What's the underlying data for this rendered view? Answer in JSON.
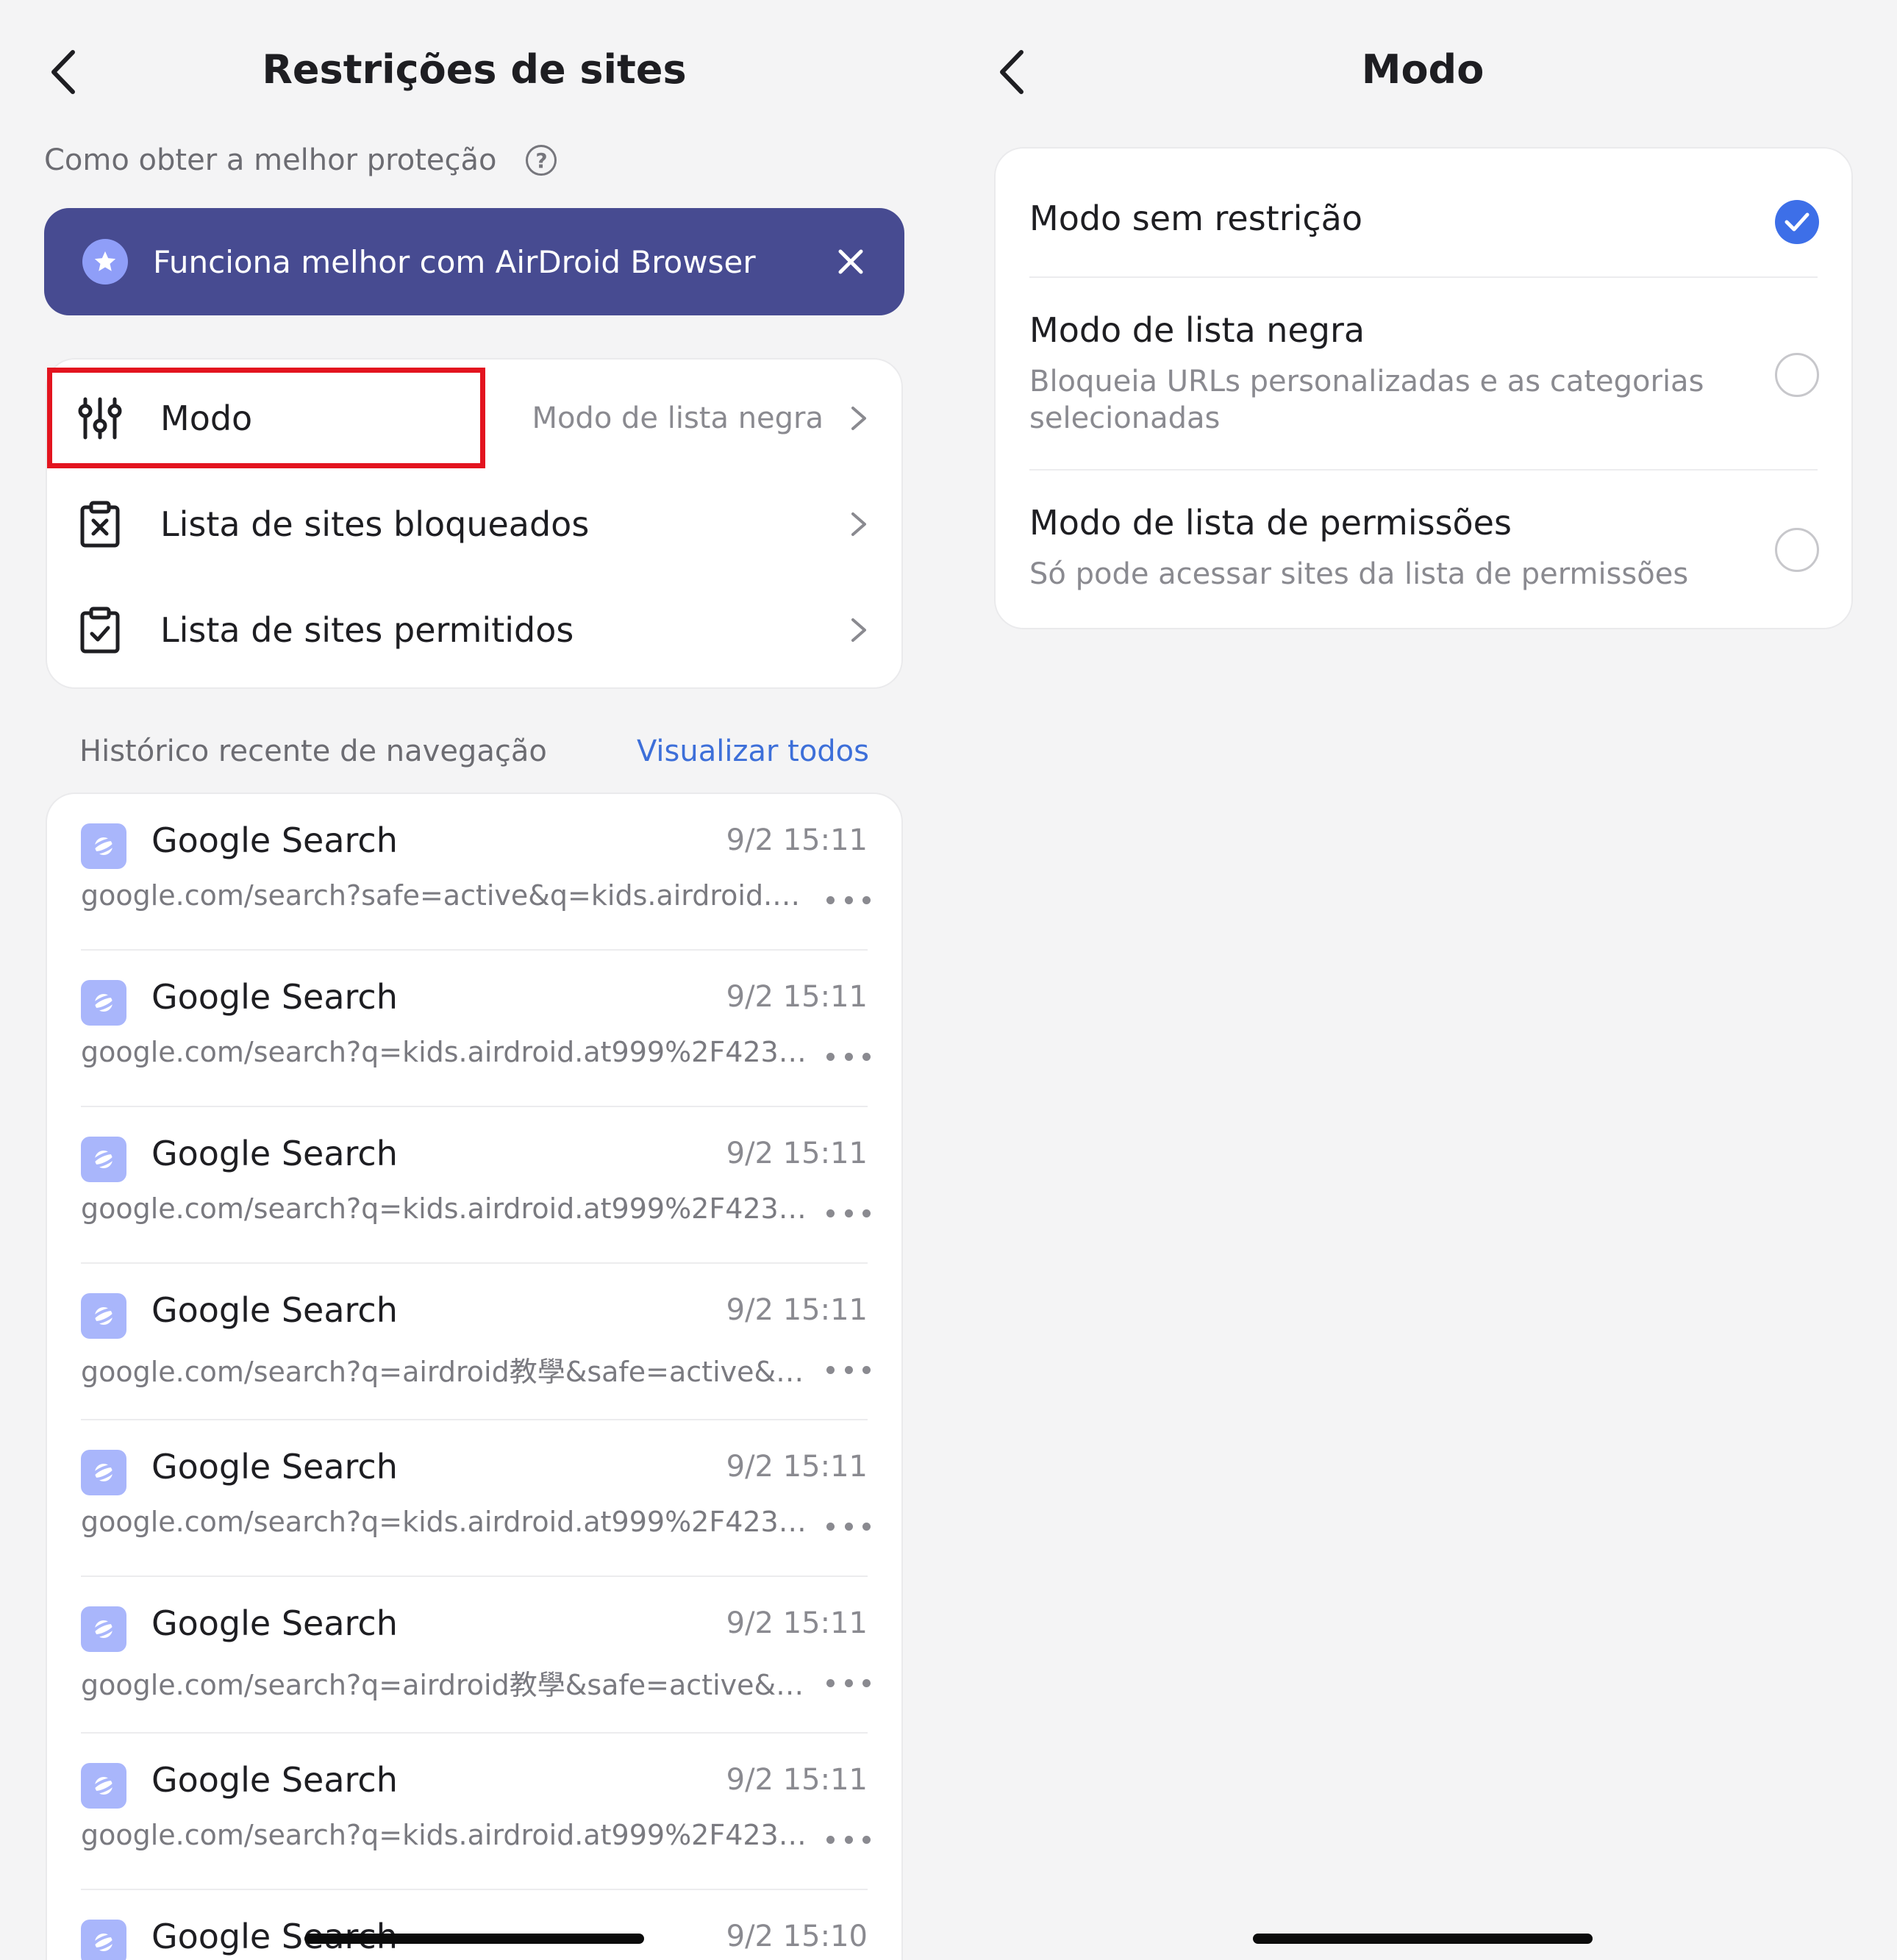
{
  "left": {
    "title": "Restrições de sites",
    "howto_label": "Como obter a melhor proteção",
    "banner_text": "Funciona melhor com AirDroid Browser",
    "menu": {
      "mode_label": "Modo",
      "mode_value": "Modo de lista negra",
      "blocked_label": "Lista de sites bloqueados",
      "allowed_label": "Lista de sites permitidos"
    },
    "history": {
      "header": "Histórico recente de navegação",
      "view_all": "Visualizar todos",
      "items": [
        {
          "title": "Google Search",
          "time": "9/2 15:11",
          "url": "google.com/search?safe=active&q=kids.airdroid.at99…"
        },
        {
          "title": "Google Search",
          "time": "9/2 15:11",
          "url": "google.com/search?q=kids.airdroid.at999%2F423885…"
        },
        {
          "title": "Google Search",
          "time": "9/2 15:11",
          "url": "google.com/search?q=kids.airdroid.at999%2F423885…"
        },
        {
          "title": "Google Search",
          "time": "9/2 15:11",
          "url": "google.com/search?q=airdroid教學&safe=active&sca_…"
        },
        {
          "title": "Google Search",
          "time": "9/2 15:11",
          "url": "google.com/search?q=kids.airdroid.at999%2F423885…"
        },
        {
          "title": "Google Search",
          "time": "9/2 15:11",
          "url": "google.com/search?q=airdroid教學&safe=active&sca_…"
        },
        {
          "title": "Google Search",
          "time": "9/2 15:11",
          "url": "google.com/search?q=kids.airdroid.at999%2F423885…"
        },
        {
          "title": "Google Search",
          "time": "9/2 15:10",
          "url": ""
        }
      ]
    }
  },
  "right": {
    "title": "Modo",
    "options": [
      {
        "title": "Modo sem restrição",
        "desc": "",
        "checked": true
      },
      {
        "title": "Modo de lista negra",
        "desc": "Bloqueia URLs personalizadas e as categorias selecionadas",
        "checked": false
      },
      {
        "title": "Modo de lista de permissões",
        "desc": "Só pode acessar sites da lista de permissões",
        "checked": false
      }
    ]
  },
  "colors": {
    "accent": "#3d6fe8",
    "banner": "#474b91",
    "highlight": "#e3141f",
    "link": "#3d6fd9"
  },
  "icons": {
    "back": "chevron-left-icon",
    "help": "question-circle-icon",
    "banner": "star-icon",
    "close": "close-icon",
    "mode": "sliders-icon",
    "blocked": "clipboard-x-icon",
    "allowed": "clipboard-check-icon",
    "favicon": "browser-favicon-icon",
    "more": "more-dots-icon",
    "check": "checkmark-icon"
  }
}
